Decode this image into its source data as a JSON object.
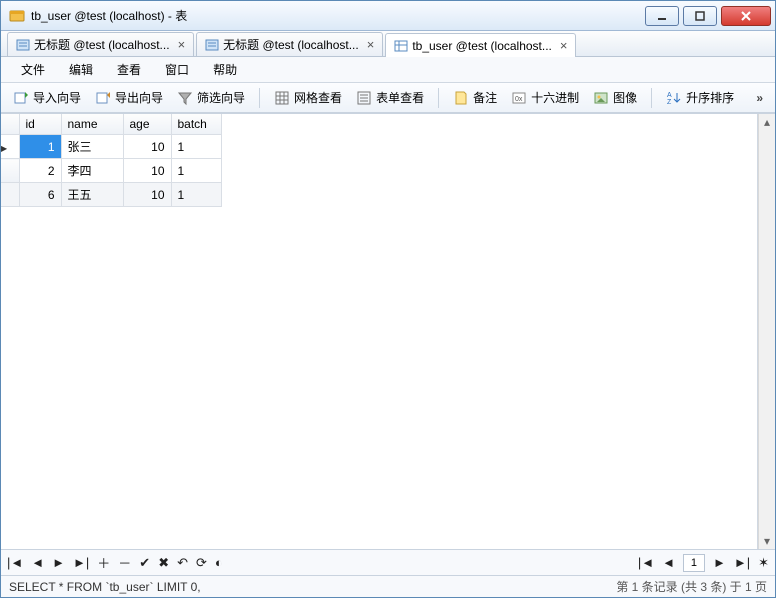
{
  "window": {
    "title": "tb_user @test (localhost) - 表"
  },
  "tabs": [
    {
      "label": "无标题 @test (localhost...",
      "active": false
    },
    {
      "label": "无标题 @test (localhost...",
      "active": false
    },
    {
      "label": "tb_user @test (localhost...",
      "active": true
    }
  ],
  "menu": {
    "file": "文件",
    "edit": "编辑",
    "view": "查看",
    "window": "窗口",
    "help": "帮助"
  },
  "toolbar": {
    "import_wizard": "导入向导",
    "export_wizard": "导出向导",
    "filter_wizard": "筛选向导",
    "grid_view": "网格查看",
    "form_view": "表单查看",
    "note": "备注",
    "hex": "十六进制",
    "image": "图像",
    "sort_asc": "升序排序"
  },
  "table": {
    "columns": [
      "id",
      "name",
      "age",
      "batch"
    ],
    "rows": [
      {
        "id": 1,
        "name": "张三",
        "age": 10,
        "batch": 1,
        "selected": true
      },
      {
        "id": 2,
        "name": "李四",
        "age": 10,
        "batch": 1,
        "selected": false
      },
      {
        "id": 6,
        "name": "王五",
        "age": 10,
        "batch": 1,
        "selected": false
      }
    ]
  },
  "nav": {
    "page": "1"
  },
  "status": {
    "query": "SELECT * FROM `tb_user` LIMIT 0,",
    "info": "第 1 条记录 (共 3 条) 于 1 页"
  }
}
